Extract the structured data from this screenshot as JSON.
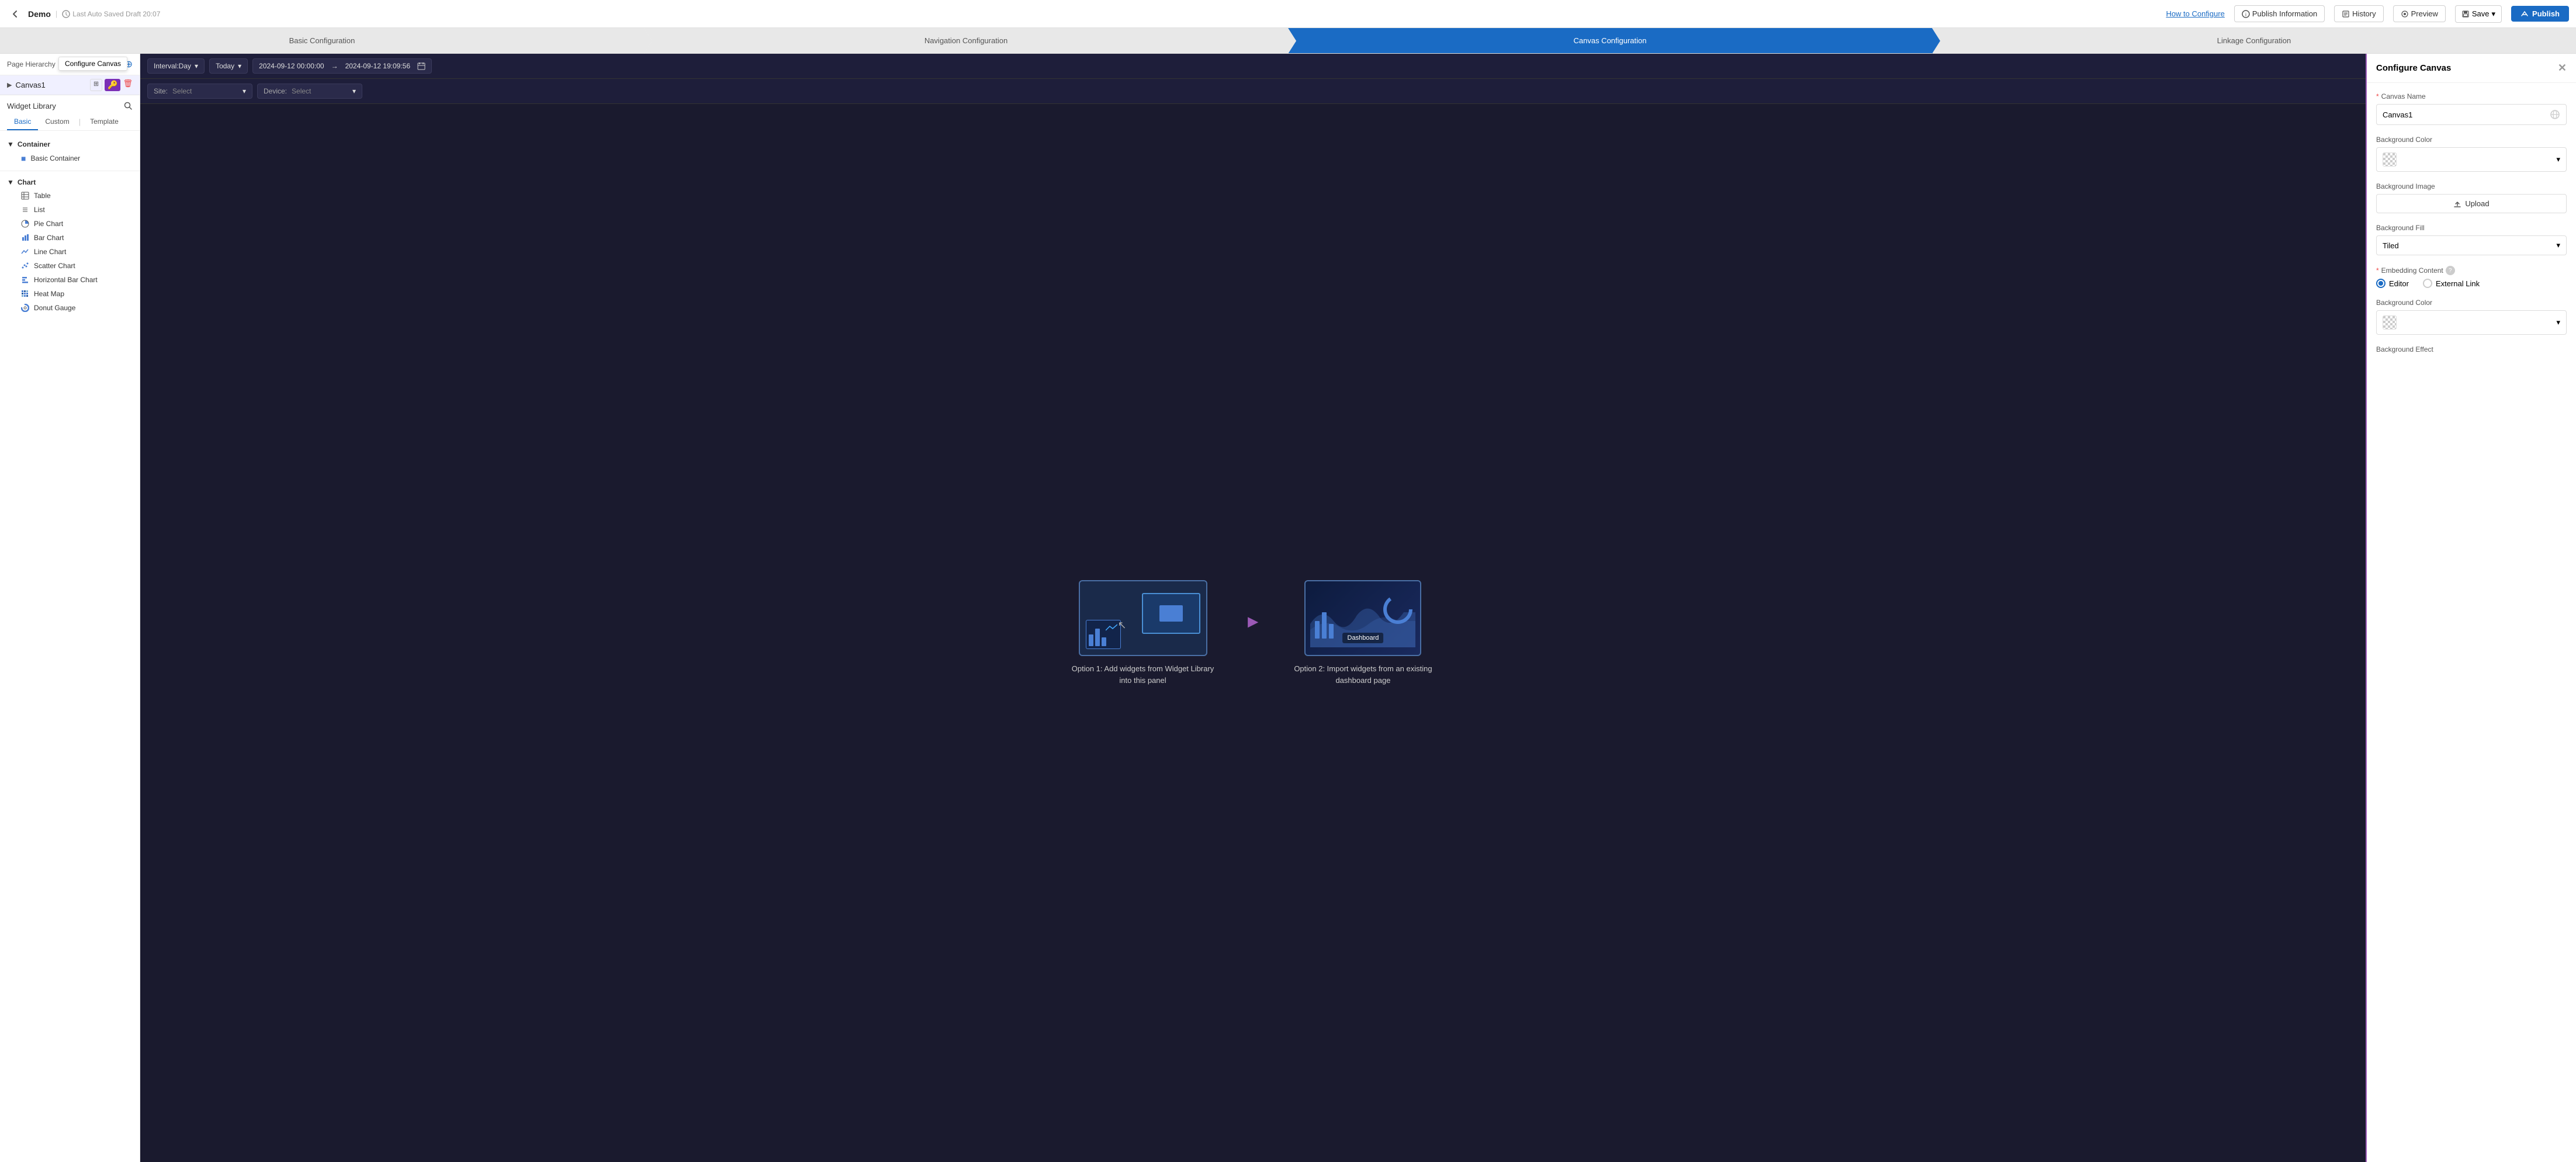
{
  "topbar": {
    "back_label": "←",
    "app_title": "Demo",
    "separator": "|",
    "auto_saved": "Last Auto Saved Draft 20:07",
    "how_to_configure": "How to Configure",
    "publish_information": "Publish Information",
    "history": "History",
    "preview": "Preview",
    "save": "Save",
    "publish": "Publish"
  },
  "steps": [
    {
      "id": "basic",
      "label": "Basic Configuration",
      "active": false
    },
    {
      "id": "navigation",
      "label": "Navigation Configuration",
      "active": false
    },
    {
      "id": "canvas",
      "label": "Canvas Configuration",
      "active": true
    },
    {
      "id": "linkage",
      "label": "Linkage Configuration",
      "active": false
    }
  ],
  "sidebar": {
    "page_hierarchy_label": "Page Hierarchy",
    "add_icon": "+",
    "canvas_item": "Canvas1",
    "configure_canvas_tooltip": "Configure Canvas",
    "widget_library_label": "Widget Library",
    "tabs": [
      {
        "id": "basic",
        "label": "Basic",
        "active": true
      },
      {
        "id": "custom",
        "label": "Custom",
        "active": false
      },
      {
        "id": "template",
        "label": "Template",
        "active": false
      }
    ],
    "groups": [
      {
        "id": "container",
        "label": "Container",
        "expanded": true,
        "items": [
          {
            "id": "basic-container",
            "label": "Basic Container",
            "icon": "■"
          }
        ]
      },
      {
        "id": "chart",
        "label": "Chart",
        "expanded": true,
        "items": [
          {
            "id": "table",
            "label": "Table",
            "icon": "⊞"
          },
          {
            "id": "list",
            "label": "List",
            "icon": "≡"
          },
          {
            "id": "pie-chart",
            "label": "Pie Chart",
            "icon": "◑"
          },
          {
            "id": "bar-chart",
            "label": "Bar Chart",
            "icon": "▐"
          },
          {
            "id": "line-chart",
            "label": "Line Chart",
            "icon": "⌇"
          },
          {
            "id": "scatter-chart",
            "label": "Scatter Chart",
            "icon": "⁚"
          },
          {
            "id": "horizontal-bar-chart",
            "label": "Horizontal Bar Chart",
            "icon": "▬"
          },
          {
            "id": "heat-map",
            "label": "Heat Map",
            "icon": "▦"
          },
          {
            "id": "donut-gauge",
            "label": "Donut Gauge",
            "icon": "◎"
          }
        ]
      }
    ]
  },
  "canvas": {
    "interval_label": "Interval:Day",
    "today_label": "Today",
    "date_start": "2024-09-12 00:00:00",
    "date_end": "2024-09-12 19:09:56",
    "site_label": "Site:",
    "site_placeholder": "Select",
    "device_label": "Device:",
    "device_placeholder": "Select",
    "option1_label": "Option 1: Add widgets from Widget Library into this panel",
    "option2_label": "Option 2: Import widgets from an existing dashboard page"
  },
  "right_panel": {
    "title": "Configure Canvas",
    "canvas_name_label": "Canvas Name",
    "canvas_name_required": "*",
    "canvas_name_value": "Canvas1",
    "background_color_label": "Background Color",
    "background_image_label": "Background Image",
    "upload_label": "Upload",
    "background_fill_label": "Background Fill",
    "background_fill_value": "Tiled",
    "embedding_content_label": "Embedding Content",
    "help_icon": "?",
    "editor_label": "Editor",
    "external_link_label": "External Link",
    "background_color_label2": "Background Color",
    "background_effect_label": "Background Effect"
  },
  "colors": {
    "active_step": "#1a6bc4",
    "accent_purple": "#9b59b6",
    "canvas_bg": "#12122a",
    "key_icon_bg": "#7b2fb5"
  }
}
